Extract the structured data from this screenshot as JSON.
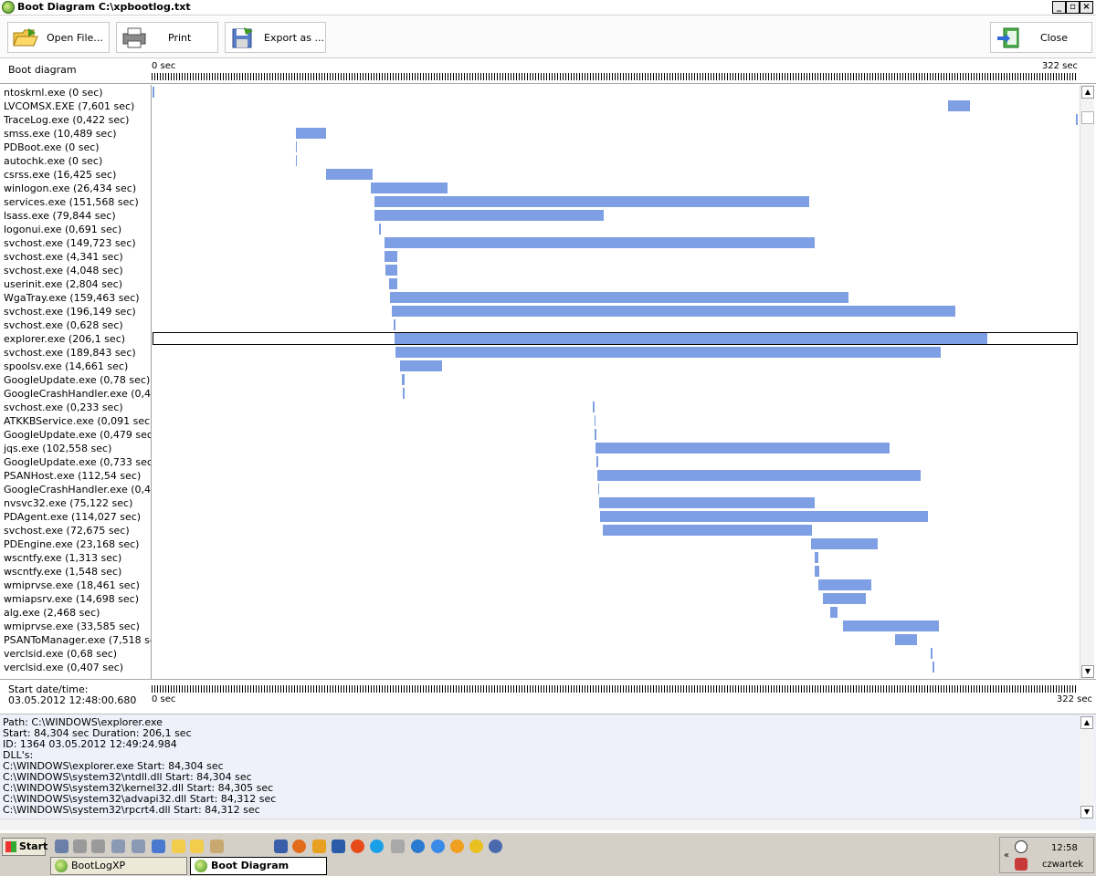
{
  "window": {
    "title": "Boot Diagram C:\\xpbootlog.txt"
  },
  "toolbar": {
    "open": "Open File...",
    "print": "Print",
    "export": "Export as ...",
    "close": "Close"
  },
  "header": {
    "label": "Boot diagram",
    "start": "0 sec",
    "end": "322 sec"
  },
  "timeline_max_sec": 322,
  "processes": [
    {
      "label": "ntoskrnl.exe (0 sec)",
      "start": 0,
      "duration": 0
    },
    {
      "label": "LVCOMSX.EXE (7,601 sec)",
      "start": 276.8,
      "duration": 7.601
    },
    {
      "label": "TraceLog.exe (0,422 sec)",
      "start": 322,
      "duration": 0.422
    },
    {
      "label": "smss.exe (10,489 sec)",
      "start": 49.9,
      "duration": 10.489
    },
    {
      "label": "PDBoot.exe (0 sec)",
      "start": 49.9,
      "duration": 0
    },
    {
      "label": "autochk.exe (0 sec)",
      "start": 49.9,
      "duration": 0
    },
    {
      "label": "csrss.exe (16,425 sec)",
      "start": 60.3,
      "duration": 16.425
    },
    {
      "label": "winlogon.exe (26,434 sec)",
      "start": 76.1,
      "duration": 26.434
    },
    {
      "label": "services.exe (151,568 sec)",
      "start": 77.1,
      "duration": 151.568
    },
    {
      "label": "lsass.exe (79,844 sec)",
      "start": 77.1,
      "duration": 79.844
    },
    {
      "label": "logonui.exe (0,691 sec)",
      "start": 78.8,
      "duration": 0.691
    },
    {
      "label": "svchost.exe (149,723 sec)",
      "start": 80.7,
      "duration": 149.723
    },
    {
      "label": "svchost.exe (4,341 sec)",
      "start": 80.7,
      "duration": 4.341
    },
    {
      "label": "svchost.exe (4,048 sec)",
      "start": 81.0,
      "duration": 4.048
    },
    {
      "label": "userinit.exe (2,804 sec)",
      "start": 82.3,
      "duration": 2.804
    },
    {
      "label": "WgaTray.exe (159,463 sec)",
      "start": 82.6,
      "duration": 159.463
    },
    {
      "label": "svchost.exe (196,149 sec)",
      "start": 83.2,
      "duration": 196.149
    },
    {
      "label": "svchost.exe (0,628 sec)",
      "start": 83.9,
      "duration": 0.628
    },
    {
      "label": "explorer.exe (206,1 sec)",
      "start": 84.304,
      "duration": 206.1,
      "selected": true
    },
    {
      "label": "svchost.exe (189,843 sec)",
      "start": 84.5,
      "duration": 189.843
    },
    {
      "label": "spoolsv.exe (14,661 sec)",
      "start": 86.1,
      "duration": 14.661
    },
    {
      "label": "GoogleUpdate.exe (0,78 sec)",
      "start": 86.8,
      "duration": 0.78
    },
    {
      "label": "GoogleCrashHandler.exe (0,47",
      "start": 87.1,
      "duration": 0.47
    },
    {
      "label": "svchost.exe (0,233 sec)",
      "start": 153.3,
      "duration": 0.233
    },
    {
      "label": "ATKKBService.exe (0,091 sec)",
      "start": 153.7,
      "duration": 0.091
    },
    {
      "label": "GoogleUpdate.exe (0,479 sec)",
      "start": 153.9,
      "duration": 0.479
    },
    {
      "label": "jqs.exe (102,558 sec)",
      "start": 154.1,
      "duration": 102.558
    },
    {
      "label": "GoogleUpdate.exe (0,733 sec)",
      "start": 154.4,
      "duration": 0.733
    },
    {
      "label": "PSANHost.exe (112,54 sec)",
      "start": 154.8,
      "duration": 112.54
    },
    {
      "label": "GoogleCrashHandler.exe (0,43",
      "start": 155.1,
      "duration": 0.43
    },
    {
      "label": "nvsvc32.exe (75,122 sec)",
      "start": 155.4,
      "duration": 75.122
    },
    {
      "label": "PDAgent.exe (114,027 sec)",
      "start": 155.7,
      "duration": 114.027
    },
    {
      "label": "svchost.exe (72,675 sec)",
      "start": 156.7,
      "duration": 72.675
    },
    {
      "label": "PDEngine.exe (23,168 sec)",
      "start": 229.1,
      "duration": 23.168
    },
    {
      "label": "wscntfy.exe (1,313 sec)",
      "start": 230.4,
      "duration": 1.313
    },
    {
      "label": "wscntfy.exe (1,548 sec)",
      "start": 230.4,
      "duration": 1.548
    },
    {
      "label": "wmiprvse.exe (18,461 sec)",
      "start": 231.7,
      "duration": 18.461
    },
    {
      "label": "wmiapsrv.exe (14,698 sec)",
      "start": 233.4,
      "duration": 14.698
    },
    {
      "label": "alg.exe (2,468 sec)",
      "start": 236.0,
      "duration": 2.468
    },
    {
      "label": "wmiprvse.exe (33,585 sec)",
      "start": 240.2,
      "duration": 33.585
    },
    {
      "label": "PSANToManager.exe (7,518 se",
      "start": 258.5,
      "duration": 7.518
    },
    {
      "label": "verclsid.exe (0,68 sec)",
      "start": 270.7,
      "duration": 0.68
    },
    {
      "label": "verclsid.exe (0,407 sec)",
      "start": 271.6,
      "duration": 0.407
    }
  ],
  "footer": {
    "start_label": "Start date/time:",
    "start_value": "03.05.2012 12:48:00.680",
    "start": "0 sec",
    "end": "322 sec"
  },
  "details": [
    "Path: C:\\WINDOWS\\explorer.exe",
    "Start: 84,304 sec Duration: 206,1 sec",
    "ID: 1364  03.05.2012  12:49:24.984",
    "DLL's:",
    "C:\\WINDOWS\\explorer.exe Start: 84,304 sec",
    "C:\\WINDOWS\\system32\\ntdll.dll Start: 84,304 sec",
    "C:\\WINDOWS\\system32\\kernel32.dll Start: 84,305 sec",
    "C:\\WINDOWS\\system32\\advapi32.dll Start: 84,312 sec",
    "C:\\WINDOWS\\system32\\rpcrt4.dll Start: 84,312 sec"
  ],
  "taskbar": {
    "start": "Start",
    "tasks": [
      {
        "label": "BootLogXP",
        "active": false
      },
      {
        "label": "Boot Diagram",
        "active": true
      }
    ],
    "clock": "12:58",
    "day": "czwartek"
  },
  "colors": {
    "bar": "#7e9fe3"
  }
}
